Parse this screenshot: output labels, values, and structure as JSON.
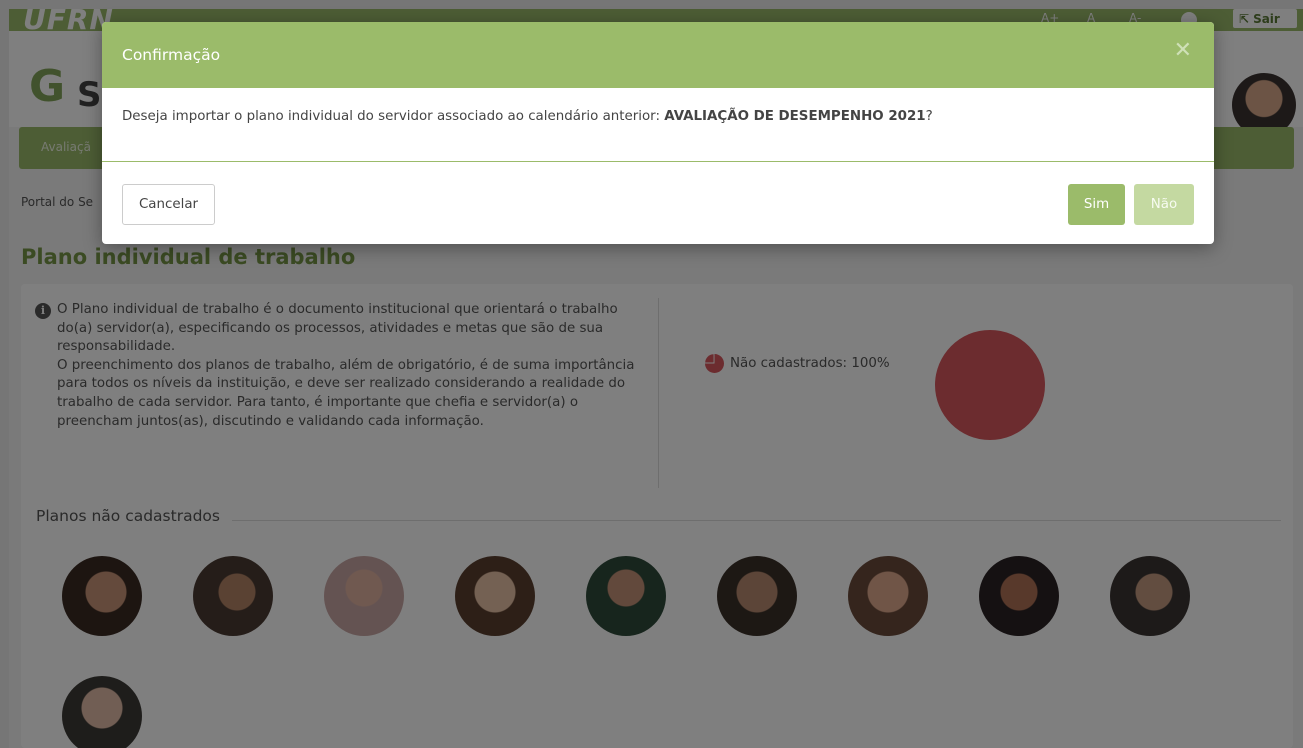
{
  "topbar": {
    "logo": "UFRN",
    "font_plus": "A+",
    "font_normal": "A",
    "font_minus": "A-",
    "logout_label": "Sair"
  },
  "navbar": {
    "item": "Avaliaçã"
  },
  "breadcrumb": "Portal do Se",
  "page": {
    "title": "Plano individual de trabalho",
    "info_paragraph_1": "O Plano individual de trabalho é o documento institucional que orientará o trabalho do(a) servidor(a), especificando os processos, atividades e metas que são de sua responsabilidade.",
    "info_paragraph_2": "O preenchimento dos planos de trabalho, além de obrigatório, é de suma importância para todos os níveis da instituição, e deve ser realizado considerando a realidade do trabalho de cada servidor. Para tanto, é importante que chefia e servidor(a) o preencham juntos(as), discutindo e validando cada informação.",
    "section_title": "Planos não cadastrados"
  },
  "chart_data": {
    "type": "pie",
    "series": [
      {
        "name": "Não cadastrados",
        "value": 100,
        "color": "#d9585f"
      }
    ],
    "legend": "Não cadastrados: 100%"
  },
  "avatars_count": 10,
  "modal": {
    "title": "Confirmação",
    "close_icon": "close-icon",
    "message_prefix": "Deseja importar o plano individual do servidor associado ao calendário anterior: ",
    "message_bold": "AVALIAÇÃO DE DESEMPENHO 2021",
    "message_suffix": "?",
    "cancel_label": "Cancelar",
    "yes_label": "Sim",
    "no_label": "Não"
  },
  "colors": {
    "accent": "#9bbb6a",
    "accent_light": "#c4d9a1",
    "title_green": "#769747",
    "pie_red": "#d9585f"
  }
}
